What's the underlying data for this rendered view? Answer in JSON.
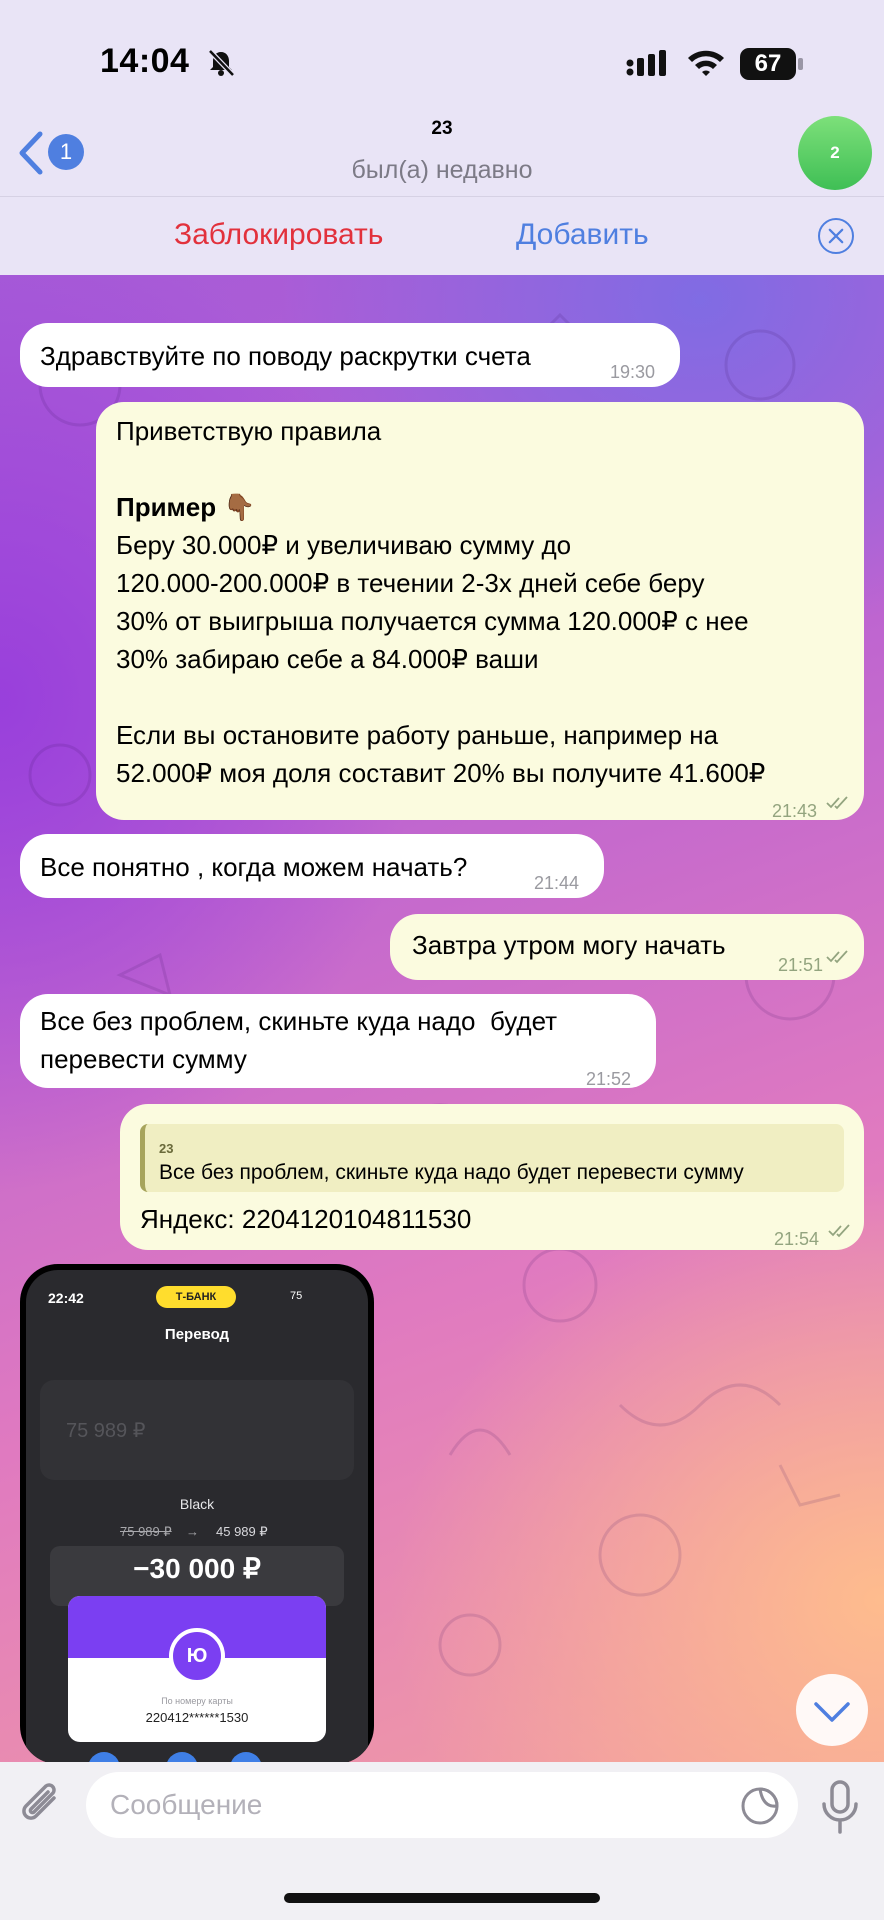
{
  "status_bar": {
    "time": "14:04",
    "battery": "67"
  },
  "header": {
    "back_badge": "1",
    "title": "23",
    "subtitle": "был(а) недавно",
    "avatar_text": "2"
  },
  "action_bar": {
    "block_label": "Заблокировать",
    "add_label": "Добавить"
  },
  "messages": [
    {
      "side": "in",
      "text": "Здравствуйте по поводу раскрутки счета",
      "time": "19:30"
    },
    {
      "side": "out",
      "line1": "Приветствую правила",
      "bold": "Пример",
      "emoji": "👇🏾",
      "body": "Беру 30.000₽ и увеличиваю сумму до\n120.000-200.000₽ в течении 2-3х дней себе беру\n30% от выигрыша получается сумма 120.000₽ с нее\n30% забираю себе а 84.000₽ ваши\n\nЕсли вы остановите работу раньше, например на\n52.000₽ моя доля составит 20% вы получите 41.600₽",
      "time": "21:43"
    },
    {
      "side": "in",
      "text": "Все понятно , когда можем начать?",
      "time": "21:44"
    },
    {
      "side": "out",
      "text": "Завтра утром могу начать",
      "time": "21:51"
    },
    {
      "side": "in",
      "text": "Все без проблем, скиньте куда надо  будет\nперевести сумму",
      "time": "21:52"
    },
    {
      "side": "out",
      "reply_name": "23",
      "reply_text": "Все без проблем, скиньте куда надо будет перевести сумму",
      "text": "Яндекс: 2204120104811530",
      "time": "21:54"
    }
  ],
  "photo": {
    "time": "22:42",
    "brand": "Т-БАНК",
    "battery": "75",
    "title": "Перевод",
    "blurred_amount": "75 989 ₽",
    "card_name": "Black",
    "old_balance": "75 989 ₽",
    "arrow": "→",
    "new_balance": "45 989 ₽",
    "amount": "−30 000 ₽",
    "card_logo": "Ю",
    "card_label": "По номеру карты",
    "card_number": "220412******1530"
  },
  "input": {
    "placeholder": "Сообщение"
  },
  "colors": {
    "block": "#e2313c",
    "accent": "#4f7fe0",
    "outgoing_bubble": "#fbfbdf",
    "incoming_bubble": "#ffffff"
  }
}
